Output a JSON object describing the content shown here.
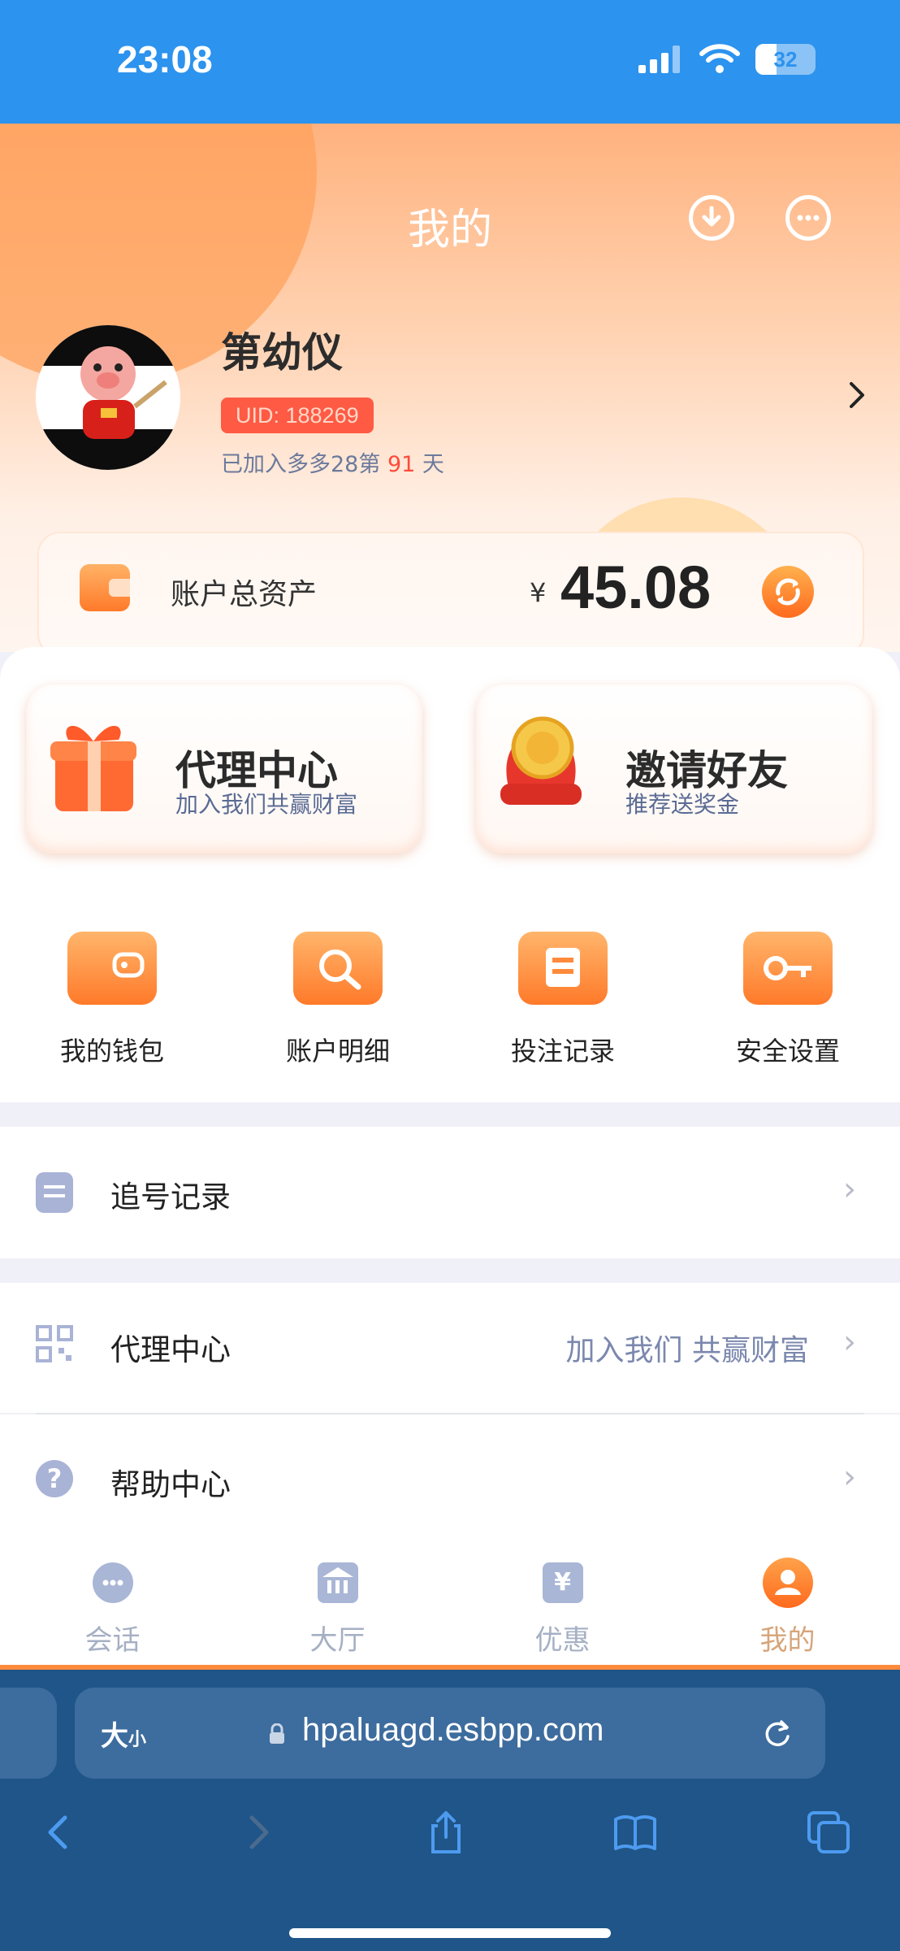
{
  "status_bar": {
    "time": "23:08",
    "battery": "32"
  },
  "header": {
    "title": "我的"
  },
  "profile": {
    "name": "第幼仪",
    "uid": "UID: 188269",
    "joined_prefix": "已加入多多28第",
    "joined_days": "91",
    "joined_suffix": "天"
  },
  "assets": {
    "label": "账户总资产",
    "currency": "¥",
    "amount": "45.08"
  },
  "promo_cards": [
    {
      "title": "代理中心",
      "subtitle": "加入我们共赢财富"
    },
    {
      "title": "邀请好友",
      "subtitle": "推荐送奖金"
    }
  ],
  "quick_actions": [
    {
      "label": "我的钱包",
      "icon": "wallet-icon"
    },
    {
      "label": "账户明细",
      "icon": "magnifier-icon"
    },
    {
      "label": "投注记录",
      "icon": "calendar-icon"
    },
    {
      "label": "安全设置",
      "icon": "key-icon"
    }
  ],
  "menu": {
    "tracking": {
      "label": "追号记录"
    },
    "agent": {
      "label": "代理中心",
      "hint": "加入我们 共赢财富"
    },
    "help": {
      "label": "帮助中心"
    }
  },
  "tabs": [
    {
      "label": "会话",
      "icon": "chat-bubble-icon",
      "active": false
    },
    {
      "label": "大厅",
      "icon": "bank-icon",
      "active": false
    },
    {
      "label": "优惠",
      "icon": "yen-ticket-icon",
      "active": false
    },
    {
      "label": "我的",
      "icon": "user-icon",
      "active": true
    }
  ],
  "browser": {
    "text_size": "大",
    "text_size_small": "小",
    "url": "hpaluagd.esbpp.com"
  },
  "colors": {
    "status_bar": "#2c93ee",
    "accent": "#ff7a2a",
    "uid_badge": "#ff5a44",
    "browser": "#1f5588"
  }
}
